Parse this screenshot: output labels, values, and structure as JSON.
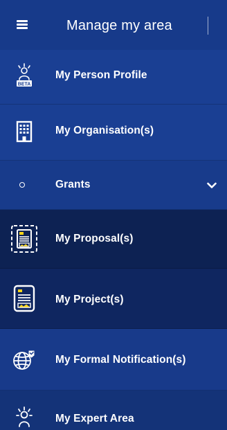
{
  "header": {
    "title": "Manage my area",
    "menu_icon": "hamburger-menu-icon"
  },
  "menu": {
    "items": [
      {
        "label": "My Person Profile",
        "icon": "beta-person-profile-icon",
        "icon_badge": "BETA"
      },
      {
        "label": "My Organisation(s)",
        "icon": "building-icon"
      },
      {
        "label": "Grants",
        "icon": "bullet-circle-icon",
        "expanded": true
      },
      {
        "label": "My Proposal(s)",
        "icon": "proposal-document-icon"
      },
      {
        "label": "My Project(s)",
        "icon": "project-document-icon"
      },
      {
        "label": "My Formal Notification(s)",
        "icon": "globe-notification-icon"
      },
      {
        "label": "My Expert Area",
        "icon": "expert-icon"
      }
    ]
  },
  "colors": {
    "sidebar_bg": "#1a3f93",
    "header_bg": "#173a8a",
    "submenu_bg": "#0d2253",
    "accent_yellow": "#ffd617",
    "text": "#ffffff"
  }
}
